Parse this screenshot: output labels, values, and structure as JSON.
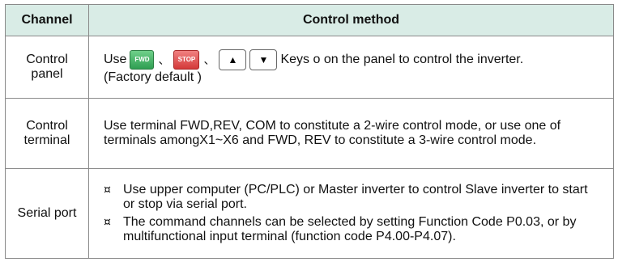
{
  "header": {
    "channel": "Channel",
    "method": "Control method"
  },
  "rows": {
    "panel": {
      "channel": "Control panel",
      "use": "Use",
      "fwd_key": "FWD",
      "stop_key": "STOP",
      "sep": "、",
      "up_key": "▲",
      "down_key": "▼",
      "text": "Keys o on the panel to control the inverter.",
      "note": "(Factory default )"
    },
    "terminal": {
      "channel": "Control terminal",
      "text": "Use terminal FWD,REV, COM to constitute a 2-wire control mode, or use one of terminals amongX1~X6 and FWD, REV to constitute a 3-wire control mode."
    },
    "serial": {
      "channel": "Serial port",
      "bullet_mark": "¤",
      "bullets": [
        "Use upper computer (PC/PLC) or Master inverter to control Slave inverter to start or stop via serial port.",
        "The command channels can be selected by setting Function Code P0.03, or by multifunctional input terminal (function code P4.00-P4.07)."
      ]
    }
  }
}
